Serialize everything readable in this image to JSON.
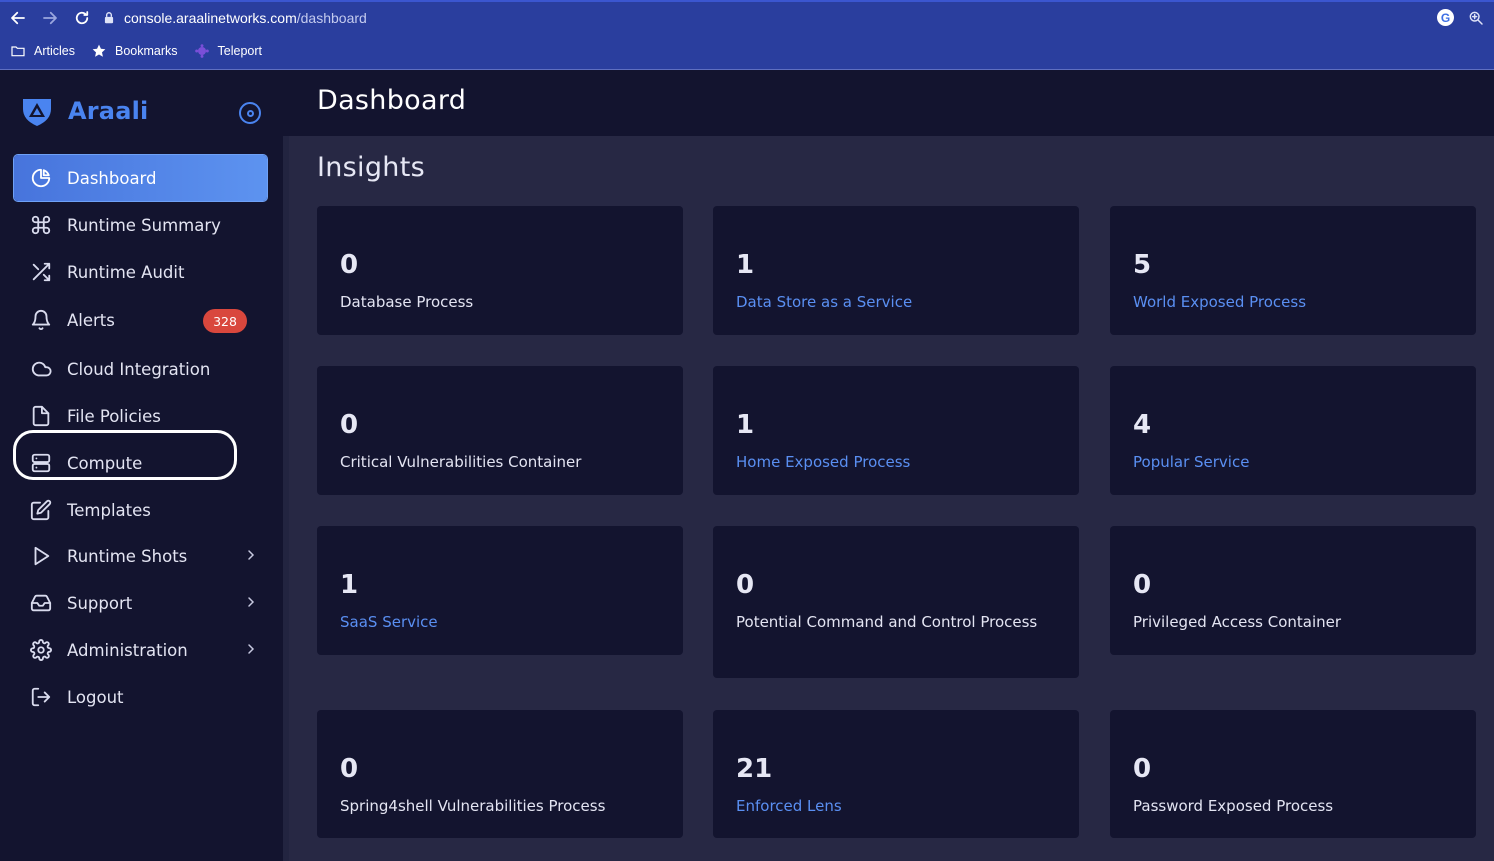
{
  "browser": {
    "url_host": "console.araalinetworks.com",
    "url_path": "/dashboard",
    "bookmarks": [
      {
        "label": "Articles",
        "icon": "folder-icon"
      },
      {
        "label": "Bookmarks",
        "icon": "star-icon"
      },
      {
        "label": "Teleport",
        "icon": "teleport-icon"
      }
    ]
  },
  "sidebar": {
    "brand": "Araali",
    "items": [
      {
        "label": "Dashboard",
        "icon": "dashboard-icon",
        "active": true
      },
      {
        "label": "Runtime Summary",
        "icon": "command-icon"
      },
      {
        "label": "Runtime Audit",
        "icon": "shuffle-icon"
      },
      {
        "label": "Alerts",
        "icon": "bell-icon",
        "badge": "328"
      },
      {
        "label": "Cloud Integration",
        "icon": "cloud-icon",
        "highlighted": true
      },
      {
        "label": "File Policies",
        "icon": "file-icon"
      },
      {
        "label": "Compute",
        "icon": "server-icon"
      },
      {
        "label": "Templates",
        "icon": "edit-icon"
      },
      {
        "label": "Runtime Shots",
        "icon": "play-icon",
        "expandable": true
      },
      {
        "label": "Support",
        "icon": "inbox-icon",
        "expandable": true
      },
      {
        "label": "Administration",
        "icon": "settings-icon",
        "expandable": true
      },
      {
        "label": "Logout",
        "icon": "logout-icon"
      }
    ]
  },
  "header": {
    "title": "Dashboard"
  },
  "main": {
    "section_title": "Insights",
    "cards": [
      {
        "value": "0",
        "label": "Database Process",
        "link": false
      },
      {
        "value": "1",
        "label": "Data Store as a Service",
        "link": true
      },
      {
        "value": "5",
        "label": "World Exposed Process",
        "link": true
      },
      {
        "value": "0",
        "label": "Critical Vulnerabilities Container",
        "link": false
      },
      {
        "value": "1",
        "label": "Home Exposed Process",
        "link": true
      },
      {
        "value": "4",
        "label": "Popular Service",
        "link": true
      },
      {
        "value": "1",
        "label": "SaaS Service",
        "link": true
      },
      {
        "value": "0",
        "label": "Potential Command and Control Process",
        "link": false
      },
      {
        "value": "0",
        "label": "Privileged Access Container",
        "link": false
      },
      {
        "value": "0",
        "label": "Spring4shell Vulnerabilities Process",
        "link": false
      },
      {
        "value": "21",
        "label": "Enforced Lens",
        "link": true
      },
      {
        "value": "0",
        "label": "Password Exposed Process",
        "link": false
      }
    ]
  },
  "colors": {
    "sidebar_bg": "#13142f",
    "content_bg": "#272844",
    "accent": "#4a84f0",
    "link": "#5a8ff2",
    "badge": "#d9473d"
  }
}
